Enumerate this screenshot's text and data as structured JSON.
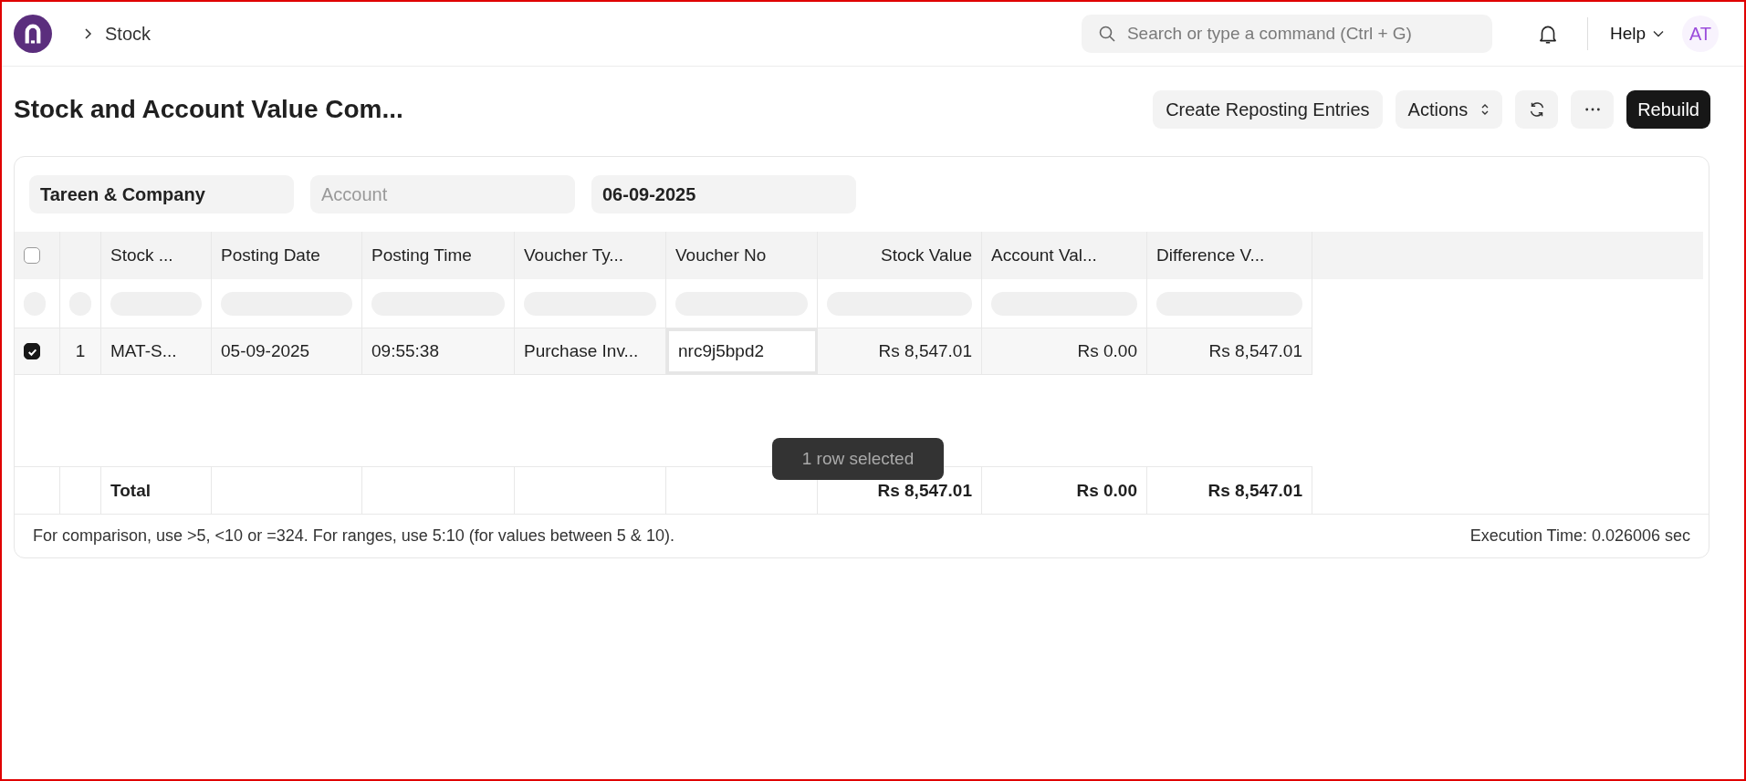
{
  "navbar": {
    "breadcrumb": "Stock",
    "search": {
      "placeholder": "Search or type a command (Ctrl + G)"
    },
    "help": "Help",
    "avatar": "AT"
  },
  "page": {
    "title": "Stock and Account Value Com...",
    "buttons": [
      {
        "kind": "secondary",
        "label": "Create Reposting Entries"
      },
      {
        "kind": "dropdown",
        "label": "Actions"
      },
      {
        "kind": "refresh"
      },
      {
        "kind": "more"
      },
      {
        "kind": "primary",
        "label": "Rebuild"
      }
    ]
  },
  "filters": [
    {
      "value": "Tareen & Company"
    },
    {
      "placeholder": "Account"
    },
    {
      "value": "06-09-2025"
    }
  ],
  "table": {
    "all_selected": false,
    "columns": [
      {
        "label": "Stock ..."
      },
      {
        "label": "Posting Date"
      },
      {
        "label": "Posting Time"
      },
      {
        "label": "Voucher Ty..."
      },
      {
        "label": "Voucher No"
      },
      {
        "label": "Stock Value"
      },
      {
        "label": "Account Val..."
      },
      {
        "label": "Difference V..."
      }
    ],
    "rows": [
      {
        "selected": true,
        "index": "1",
        "cells": [
          {
            "text": "MAT-S...",
            "focused": false
          },
          {
            "text": "05-09-2025",
            "focused": false
          },
          {
            "text": "09:55:38",
            "focused": false
          },
          {
            "text": "Purchase Inv...",
            "focused": false
          },
          {
            "text": "nrc9j5bpd2",
            "focused": true
          },
          {
            "text": "Rs 8,547.01",
            "focused": false
          },
          {
            "text": "Rs 0.00",
            "focused": false
          },
          {
            "text": "Rs 8,547.01",
            "focused": false
          }
        ]
      }
    ],
    "total": {
      "label": "Total",
      "values": [
        "Rs 8,547.01",
        "Rs 0.00",
        "Rs 8,547.01"
      ]
    }
  },
  "toast": "1 row selected",
  "footer": {
    "hint": "For comparison, use >5, <10 or =324. For ranges, use 5:10 (for values between 5 & 10).",
    "execution_time": "Execution Time: 0.026006 sec"
  }
}
